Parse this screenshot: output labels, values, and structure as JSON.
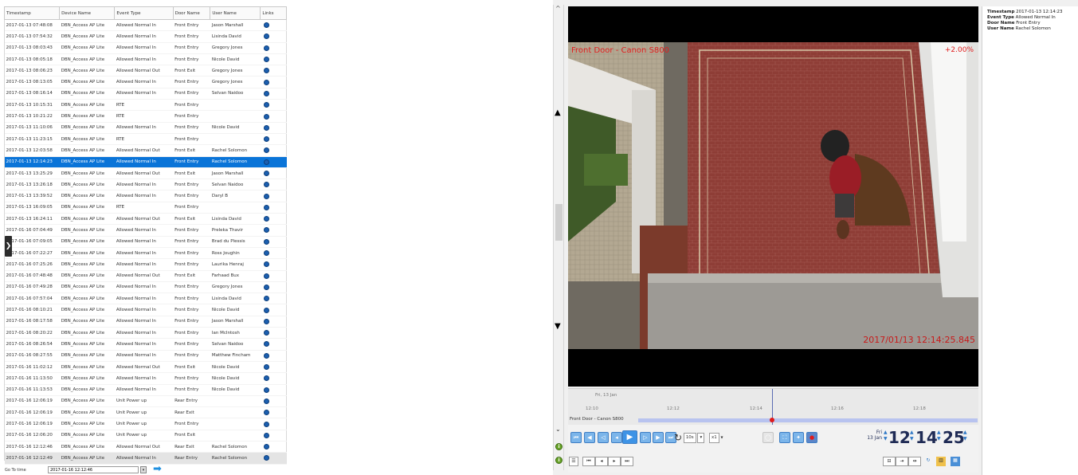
{
  "table": {
    "columns": [
      "Timestamp",
      "Device Name",
      "Event Type",
      "Door Name",
      "User Name",
      "Links"
    ],
    "rows": [
      [
        "2017-01-13 07:48:08",
        "DBN_Access AP Lite",
        "Allowed Normal In",
        "Front Entry",
        "Jason Marshall"
      ],
      [
        "2017-01-13 07:54:32",
        "DBN_Access AP Lite",
        "Allowed Normal In",
        "Front Entry",
        "Lisinda David"
      ],
      [
        "2017-01-13 08:03:43",
        "DBN_Access AP Lite",
        "Allowed Normal In",
        "Front Entry",
        "Gregory Jones"
      ],
      [
        "2017-01-13 08:05:18",
        "DBN_Access AP Lite",
        "Allowed Normal In",
        "Front Entry",
        "Nicole David"
      ],
      [
        "2017-01-13 08:06:23",
        "DBN_Access AP Lite",
        "Allowed Normal Out",
        "Front Exit",
        "Gregory Jones"
      ],
      [
        "2017-01-13 08:13:05",
        "DBN_Access AP Lite",
        "Allowed Normal In",
        "Front Entry",
        "Gregory Jones"
      ],
      [
        "2017-01-13 08:16:14",
        "DBN_Access AP Lite",
        "Allowed Normal In",
        "Front Entry",
        "Selvan Naidoo"
      ],
      [
        "2017-01-13 10:15:31",
        "DBN_Access AP Lite",
        "RTE",
        "Front Entry",
        ""
      ],
      [
        "2017-01-13 10:21:22",
        "DBN_Access AP Lite",
        "RTE",
        "Front Entry",
        ""
      ],
      [
        "2017-01-13 11:10:06",
        "DBN_Access AP Lite",
        "Allowed Normal In",
        "Front Entry",
        "Nicole David"
      ],
      [
        "2017-01-13 11:23:15",
        "DBN_Access AP Lite",
        "RTE",
        "Front Entry",
        ""
      ],
      [
        "2017-01-13 12:03:58",
        "DBN_Access AP Lite",
        "Allowed Normal Out",
        "Front Exit",
        "Rachel Solomon"
      ],
      [
        "2017-01-13 12:14:23",
        "DBN_Access AP Lite",
        "Allowed Normal In",
        "Front Entry",
        "Rachel Solomon"
      ],
      [
        "2017-01-13 13:25:29",
        "DBN_Access AP Lite",
        "Allowed Normal Out",
        "Front Exit",
        "Jason Marshall"
      ],
      [
        "2017-01-13 13:26:18",
        "DBN_Access AP Lite",
        "Allowed Normal In",
        "Front Entry",
        "Selvan Naidoo"
      ],
      [
        "2017-01-13 13:39:52",
        "DBN_Access AP Lite",
        "Allowed Normal In",
        "Front Entry",
        "Daryl B"
      ],
      [
        "2017-01-13 16:09:05",
        "DBN_Access AP Lite",
        "RTE",
        "Front Entry",
        ""
      ],
      [
        "2017-01-13 16:24:11",
        "DBN_Access AP Lite",
        "Allowed Normal Out",
        "Front Exit",
        "Lisinda David"
      ],
      [
        "2017-01-16 07:04:49",
        "DBN_Access AP Lite",
        "Allowed Normal In",
        "Front Entry",
        "Preleka Thavir"
      ],
      [
        "2017-01-16 07:09:05",
        "DBN_Access AP Lite",
        "Allowed Normal In",
        "Front Entry",
        "Brad du Plessis"
      ],
      [
        "2017-01-16 07:22:27",
        "DBN_Access AP Lite",
        "Allowed Normal In",
        "Front Entry",
        "Ross Joughin"
      ],
      [
        "2017-01-16 07:25:26",
        "DBN_Access AP Lite",
        "Allowed Normal In",
        "Front Entry",
        "Laurika Henraj"
      ],
      [
        "2017-01-16 07:48:48",
        "DBN_Access AP Lite",
        "Allowed Normal Out",
        "Front Exit",
        "Farhaad Bux"
      ],
      [
        "2017-01-16 07:49:28",
        "DBN_Access AP Lite",
        "Allowed Normal In",
        "Front Entry",
        "Gregory Jones"
      ],
      [
        "2017-01-16 07:57:04",
        "DBN_Access AP Lite",
        "Allowed Normal In",
        "Front Entry",
        "Lisinda David"
      ],
      [
        "2017-01-16 08:10:21",
        "DBN_Access AP Lite",
        "Allowed Normal In",
        "Front Entry",
        "Nicole David"
      ],
      [
        "2017-01-16 08:17:58",
        "DBN_Access AP Lite",
        "Allowed Normal In",
        "Front Entry",
        "Jason Marshall"
      ],
      [
        "2017-01-16 08:20:22",
        "DBN_Access AP Lite",
        "Allowed Normal In",
        "Front Entry",
        "Ian McIntosh"
      ],
      [
        "2017-01-16 08:26:54",
        "DBN_Access AP Lite",
        "Allowed Normal In",
        "Front Entry",
        "Selvan Naidoo"
      ],
      [
        "2017-01-16 08:27:55",
        "DBN_Access AP Lite",
        "Allowed Normal In",
        "Front Entry",
        "Matthew Fincham"
      ],
      [
        "2017-01-16 11:02:12",
        "DBN_Access AP Lite",
        "Allowed Normal Out",
        "Front Exit",
        "Nicole David"
      ],
      [
        "2017-01-16 11:13:50",
        "DBN_Access AP Lite",
        "Allowed Normal In",
        "Front Entry",
        "Nicole David"
      ],
      [
        "2017-01-16 11:13:53",
        "DBN_Access AP Lite",
        "Allowed Normal In",
        "Front Entry",
        "Nicole David"
      ],
      [
        "2017-01-16 12:06:19",
        "DBN_Access AP Lite",
        "Unit Power up",
        "Rear Entry",
        ""
      ],
      [
        "2017-01-16 12:06:19",
        "DBN_Access AP Lite",
        "Unit Power up",
        "Rear Exit",
        ""
      ],
      [
        "2017-01-16 12:06:19",
        "DBN_Access AP Lite",
        "Unit Power up",
        "Front Entry",
        ""
      ],
      [
        "2017-01-16 12:06:20",
        "DBN_Access AP Lite",
        "Unit Power up",
        "Front Exit",
        ""
      ],
      [
        "2017-01-16 12:12:46",
        "DBN_Access AP Lite",
        "Allowed Normal Out",
        "Rear Exit",
        "Rachel Solomon"
      ],
      [
        "2017-01-16 12:12:49",
        "DBN_Access AP Lite",
        "Allowed Normal In",
        "Rear Entry",
        "Rachel Solomon"
      ]
    ],
    "selected_index": 12,
    "last_index": 38
  },
  "goto": {
    "label": "Go To time",
    "value": "2017-01-16 12:12:46"
  },
  "video": {
    "camera_label": "Front Door - Canon S800",
    "zoom": "+2.00%",
    "timestamp": "2017/01/13 12:14:25.845"
  },
  "timeline": {
    "day_label": "Fri, 13 Jan",
    "ticks": [
      "12:10",
      "12:12",
      "12:14",
      "12:16",
      "12:18"
    ],
    "track_label": "Front Door - Canon S800"
  },
  "controls": {
    "rate_label": "10s",
    "speed": "x1",
    "clock_day_1": "Fri",
    "clock_day_2": "13 Jan",
    "hours": "12",
    "minutes": "14",
    "seconds": "25"
  },
  "info": {
    "timestamp_label": "Timestamp",
    "timestamp_value": "2017-01-13 12:14:23",
    "event_label": "Event Type",
    "event_value": "Allowed Normal In",
    "door_label": "Door Name",
    "door_value": "Front Entry",
    "user_label": "User Name",
    "user_value": "Rachel Solomon"
  },
  "colors": {
    "selection": "#0a74d8",
    "overlay_text": "#e02020",
    "accent": "#3d93e6"
  }
}
